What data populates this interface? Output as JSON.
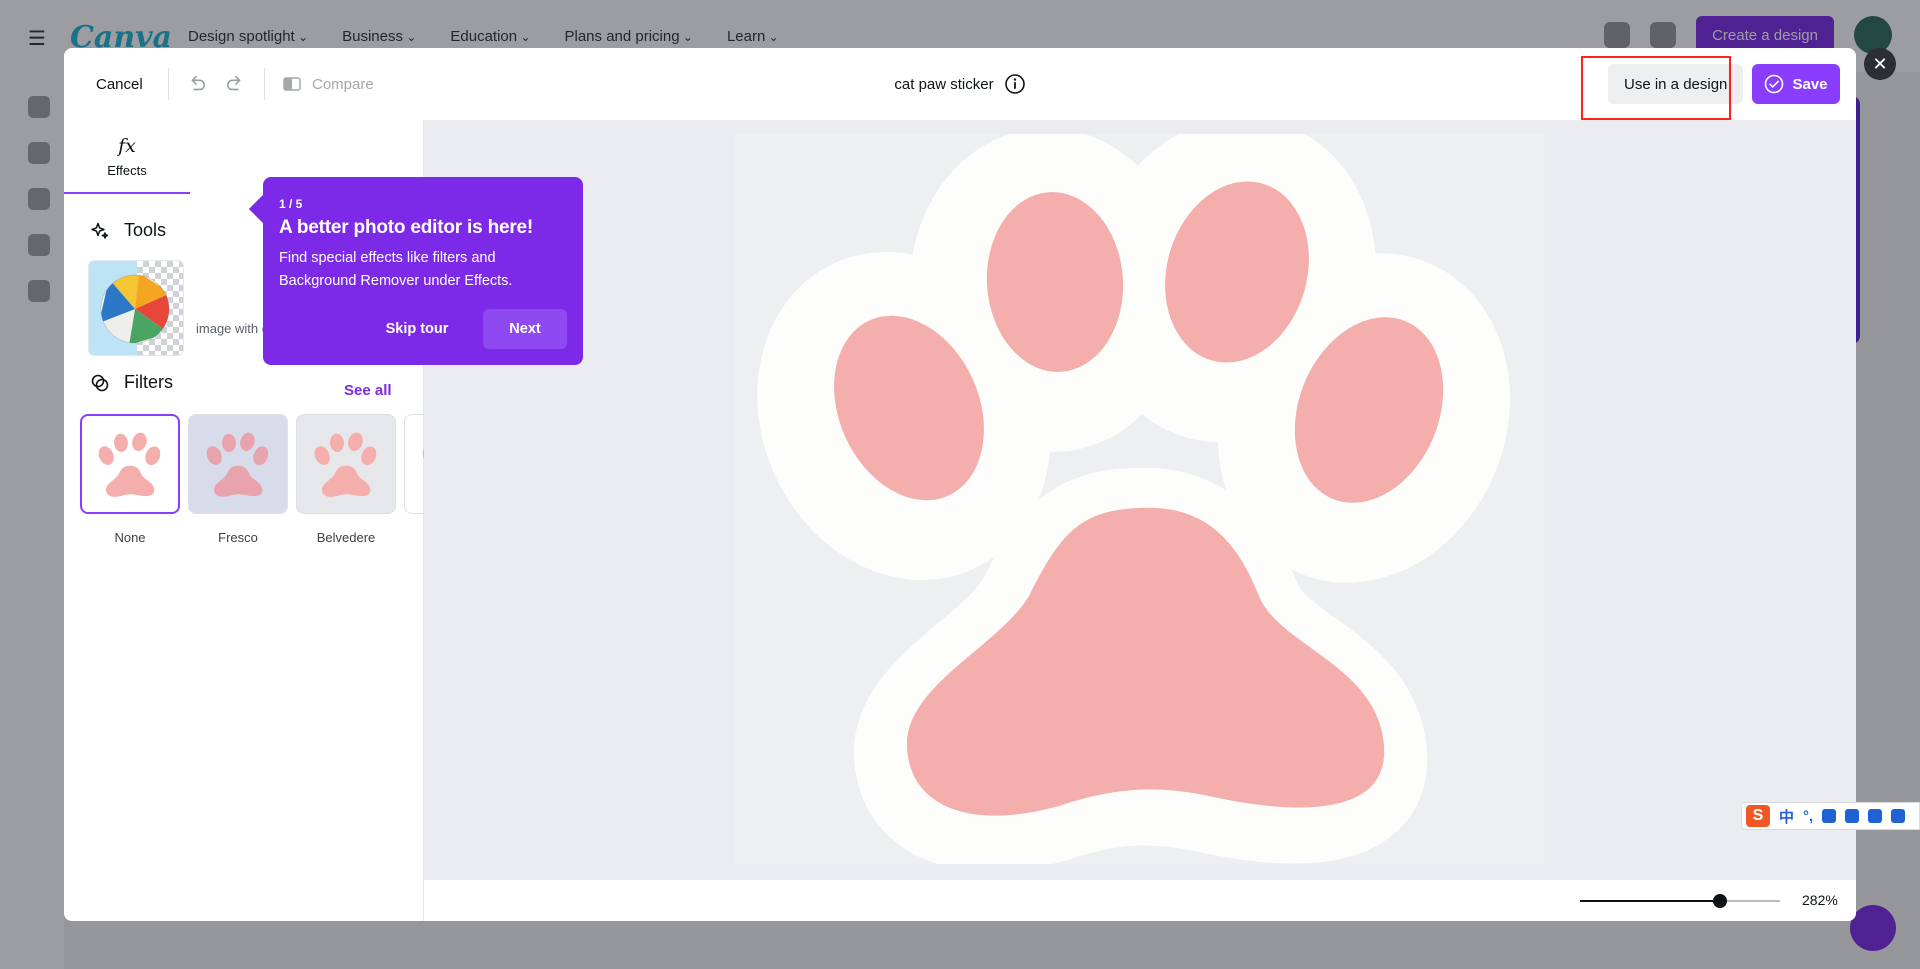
{
  "background_app": {
    "logo": "Canva",
    "nav": [
      "Design spotlight",
      "Business",
      "Education",
      "Plans and pricing",
      "Learn"
    ],
    "create_label": "Create a design"
  },
  "header": {
    "cancel_label": "Cancel",
    "compare_label": "Compare",
    "title": "cat paw sticker",
    "use_in_design_label": "Use in a design",
    "save_label": "Save"
  },
  "panel": {
    "tabs": [
      {
        "label": "Effects",
        "icon": "fx-icon"
      }
    ],
    "tools_title": "Tools",
    "tool_desc": "image with one click.",
    "filters_title": "Filters",
    "see_all_label": "See all",
    "filters": [
      {
        "label": "None",
        "selected": true,
        "bg": "#ffffff"
      },
      {
        "label": "Fresco",
        "selected": false,
        "bg": "#d8dcea"
      },
      {
        "label": "Belvedere",
        "selected": false,
        "bg": "#e6e7ea"
      }
    ]
  },
  "tour": {
    "step": "1 / 5",
    "title": "A better photo editor is here!",
    "body": "Find special effects like filters and Background Remover under Effects.",
    "skip_label": "Skip tour",
    "next_label": "Next"
  },
  "canvas": {
    "paw_color": "#f4aeab",
    "outline_color": "#fdfdfc"
  },
  "zoom": {
    "value_label": "282%",
    "slider_fraction": 0.7
  },
  "colors": {
    "accent": "#8b3dff",
    "tour_bg": "#7d2ae8",
    "highlight": "#ff1f1f"
  },
  "ime": {
    "logo": "S",
    "lang": "中",
    "punct": "°,"
  }
}
